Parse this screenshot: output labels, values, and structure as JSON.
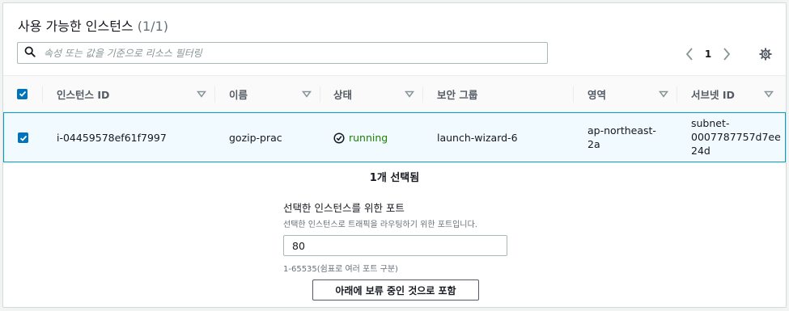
{
  "panel": {
    "title": "사용 가능한 인스턴스",
    "count": "(1/1)"
  },
  "search": {
    "placeholder": "속성 또는 값을 기준으로 리소스 필터링",
    "icon": "search-icon"
  },
  "pagination": {
    "current_page": "1"
  },
  "table": {
    "columns": [
      {
        "label": "인스턴스 ID"
      },
      {
        "label": "이름"
      },
      {
        "label": "상태"
      },
      {
        "label": "보안 그룹"
      },
      {
        "label": "영역"
      },
      {
        "label": "서브넷 ID"
      }
    ],
    "rows": [
      {
        "checked": true,
        "instance_id": "i-04459578ef61f7997",
        "name": "gozip-prac",
        "state": "running",
        "security_group": "launch-wizard-6",
        "zone_line1": "ap-northeast-",
        "zone_line2": "2a",
        "subnet_line1": "subnet-",
        "subnet_line2": "0007787757d7ee",
        "subnet_line3": "24d"
      }
    ]
  },
  "selection": {
    "summary": "1개 선택됨"
  },
  "port_form": {
    "label": "선택한 인스턴스를 위한 포트",
    "description": "선택한 인스턴스로 트래픽을 라우팅하기 위한 포트입니다.",
    "value": "80",
    "hint": "1-65535(쉼표로 여러 포트 구분)"
  },
  "actions": {
    "include_pending_label": "아래에 보류 중인 것으로 포함"
  },
  "colors": {
    "accent": "#0073bb",
    "running": "#1d8102",
    "selected_row_bg": "#f1faff",
    "selected_row_border": "#00a1c9"
  }
}
